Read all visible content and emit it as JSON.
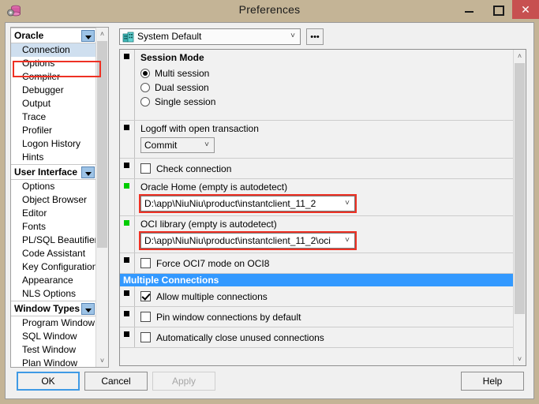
{
  "window": {
    "title": "Preferences",
    "icon": "database-gear-icon",
    "controls": {
      "minimize": "minimize-icon",
      "maximize": "maximize-icon",
      "close": "✕"
    },
    "titlebar_color": "#c4b496",
    "close_button_color": "#c75050"
  },
  "sidebar": {
    "groups": [
      {
        "label": "Oracle",
        "items": [
          {
            "label": "Connection",
            "selected": true,
            "highlighted": true
          },
          {
            "label": "Options",
            "selected": false
          },
          {
            "label": "Compiler",
            "selected": false
          },
          {
            "label": "Debugger",
            "selected": false
          },
          {
            "label": "Output",
            "selected": false
          },
          {
            "label": "Trace",
            "selected": false
          },
          {
            "label": "Profiler",
            "selected": false
          },
          {
            "label": "Logon History",
            "selected": false
          },
          {
            "label": "Hints",
            "selected": false
          }
        ]
      },
      {
        "label": "User Interface",
        "items": [
          {
            "label": "Options",
            "selected": false
          },
          {
            "label": "Object Browser",
            "selected": false
          },
          {
            "label": "Editor",
            "selected": false
          },
          {
            "label": "Fonts",
            "selected": false
          },
          {
            "label": "PL/SQL Beautifier",
            "selected": false
          },
          {
            "label": "Code Assistant",
            "selected": false
          },
          {
            "label": "Key Configuration",
            "selected": false
          },
          {
            "label": "Appearance",
            "selected": false
          },
          {
            "label": "NLS Options",
            "selected": false
          }
        ]
      },
      {
        "label": "Window Types",
        "items": [
          {
            "label": "Program Window",
            "selected": false
          },
          {
            "label": "SQL Window",
            "selected": false
          },
          {
            "label": "Test Window",
            "selected": false
          },
          {
            "label": "Plan Window",
            "selected": false
          }
        ]
      }
    ],
    "scroll_up": "˄",
    "scroll_down": "˅"
  },
  "toolbar": {
    "profile_icon": "profile-building-icon",
    "profile_value": "System Default",
    "profile_arrow": "˅",
    "more_button": "•••"
  },
  "preferences": {
    "scroll_up": "˄",
    "scroll_down": "˅",
    "rows": [
      {
        "type": "radio-group",
        "marker": "default",
        "title": "Session Mode",
        "options": [
          {
            "label": "Multi session",
            "checked": true
          },
          {
            "label": "Dual session",
            "checked": false
          },
          {
            "label": "Single session",
            "checked": false
          }
        ]
      },
      {
        "type": "combo",
        "marker": "default",
        "label": "Logoff with open transaction",
        "value": "Commit",
        "arrow": "˅"
      },
      {
        "type": "checkbox",
        "marker": "default",
        "label": "Check connection",
        "checked": false
      },
      {
        "type": "path-combo",
        "marker": "modified",
        "label": "Oracle Home (empty is autodetect)",
        "value": "D:\\app\\NiuNiu\\product\\instantclient_11_2",
        "arrow": "˅",
        "highlighted": true
      },
      {
        "type": "path-combo",
        "marker": "modified",
        "label": "OCI library (empty is autodetect)",
        "value": "D:\\app\\NiuNiu\\product\\instantclient_11_2\\oci",
        "arrow": "˅",
        "highlighted": true
      },
      {
        "type": "checkbox",
        "marker": "default",
        "label": "Force OCI7 mode on OCI8",
        "checked": false
      },
      {
        "type": "section",
        "label": "Multiple Connections"
      },
      {
        "type": "checkbox",
        "marker": "default",
        "label": "Allow multiple connections",
        "checked": true
      },
      {
        "type": "checkbox",
        "marker": "default",
        "label": "Pin window connections by default",
        "checked": false
      },
      {
        "type": "checkbox",
        "marker": "default",
        "label": "Automatically close unused connections",
        "checked": false
      }
    ],
    "section_color": "#3399ff"
  },
  "buttons": {
    "ok": "OK",
    "cancel": "Cancel",
    "apply": "Apply",
    "help": "Help"
  },
  "annotation_color": "#ee3124"
}
